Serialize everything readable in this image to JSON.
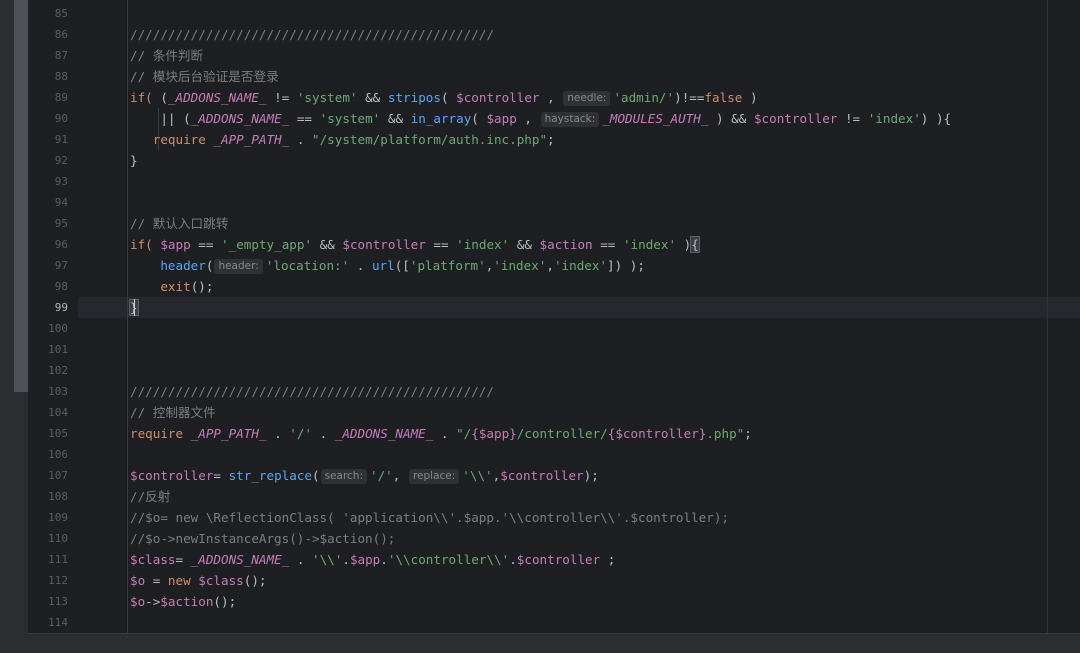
{
  "gutter": {
    "current_line": "99",
    "line_numbers": [
      "85",
      "86",
      "87",
      "88",
      "89",
      "90",
      "91",
      "92",
      "93",
      "94",
      "95",
      "96",
      "97",
      "98",
      "99",
      "100",
      "101",
      "102",
      "103",
      "104",
      "105",
      "106",
      "107",
      "108",
      "109",
      "110",
      "111",
      "112",
      "113",
      "114"
    ]
  },
  "code": {
    "l86": "////////////////////////////////////////////////",
    "l87": "// 条件判断",
    "l88": "// 模块后台验证是否登录",
    "l89": {
      "kw_if": "if(",
      "p1": " (",
      "const1": "_ADDONS_NAME_",
      "op1": " != ",
      "s1": "'system'",
      "op2": " && ",
      "fn": "stripos",
      "p2": "( ",
      "v1": "$controller",
      "p3": " ,",
      "hint": "needle:",
      "s2": "'admin/'",
      "p4": ")!==",
      "kw_false": "false",
      "p5": " )"
    },
    "l90": {
      "p1": "|| (",
      "const1": "_ADDONS_NAME_",
      "op1": " == ",
      "s1": "'system'",
      "op2": " && ",
      "fn": "in_array",
      "p2": "( ",
      "v1": "$app",
      "p3": " ,",
      "hint": "haystack:",
      "const2": "_MODULES_AUTH_",
      "p4": " ) && ",
      "v2": "$controller",
      "op3": " != ",
      "s2": "'index'",
      "p5": ") ){"
    },
    "l91": {
      "kw": "require",
      "sp": " ",
      "const1": "_APP_PATH_",
      "op": " . ",
      "s1": "\"/system/platform/auth.inc.php\"",
      "end": ";"
    },
    "l92": "}",
    "l95": "// 默认入口跳转",
    "l96": {
      "kw_if": "if(",
      "sp": " ",
      "v1": "$app",
      "op1": " == ",
      "s1": "'_empty_app'",
      "op2": " && ",
      "v2": "$controller",
      "op3": " == ",
      "s2": "'index'",
      "op4": " && ",
      "v3": "$action",
      "op5": " == ",
      "s3": "'index'",
      "p1": " )",
      "brace": "{"
    },
    "l97": {
      "fn": "header",
      "p1": "(",
      "hint": "header:",
      "s1": "'location:'",
      "op": " . ",
      "fn2": "url",
      "p2": "([",
      "s2": "'platform'",
      "c1": ",",
      "s3": "'index'",
      "c2": ",",
      "s4": "'index'",
      "p3": "]) );"
    },
    "l98": {
      "kw": "exit",
      "rest": "();"
    },
    "l99": "}",
    "l103": "////////////////////////////////////////////////",
    "l104": "// 控制器文件",
    "l105": {
      "kw": "require",
      "sp": " ",
      "const1": "_APP_PATH_",
      "op1": " . ",
      "s1": "'/'",
      "op2": " . ",
      "const2": "_ADDONS_NAME_",
      "op3": " . ",
      "s2": "\"/",
      "i1": "{$app}",
      "s3": "/controller/",
      "i2": "{$controller}",
      "s4": ".php\"",
      "end": ";"
    },
    "l107": {
      "v1": "$controller",
      "op": "= ",
      "fn": "str_replace",
      "p1": "(",
      "hint1": "search:",
      "s1": "'/'",
      "c1": ",",
      "hint2": "replace:",
      "s2": "'\\\\'",
      "c2": ",",
      "v2": "$controller",
      "end": ");"
    },
    "l108": "//反射",
    "l109": "//$o= new \\ReflectionClass( 'application\\\\'.$app.'\\\\controller\\\\'.$controller);",
    "l110": "//$o->newInstanceArgs()->$action();",
    "l111": {
      "v1": "$class",
      "op1": "= ",
      "const1": "_ADDONS_NAME_",
      "op2": " . ",
      "s1": "'\\\\'",
      "op3": ".",
      "v2": "$app",
      "op4": ".",
      "s2": "'\\\\controller\\\\'",
      "op5": ".",
      "v3": "$controller",
      "end": " ;"
    },
    "l112": {
      "v1": "$o",
      "op": " = ",
      "kw": "new",
      "sp": " ",
      "v2": "$class",
      "end": "();"
    },
    "l113": {
      "v1": "$o",
      "op": "->",
      "v2": "$action",
      "end": "();"
    }
  }
}
